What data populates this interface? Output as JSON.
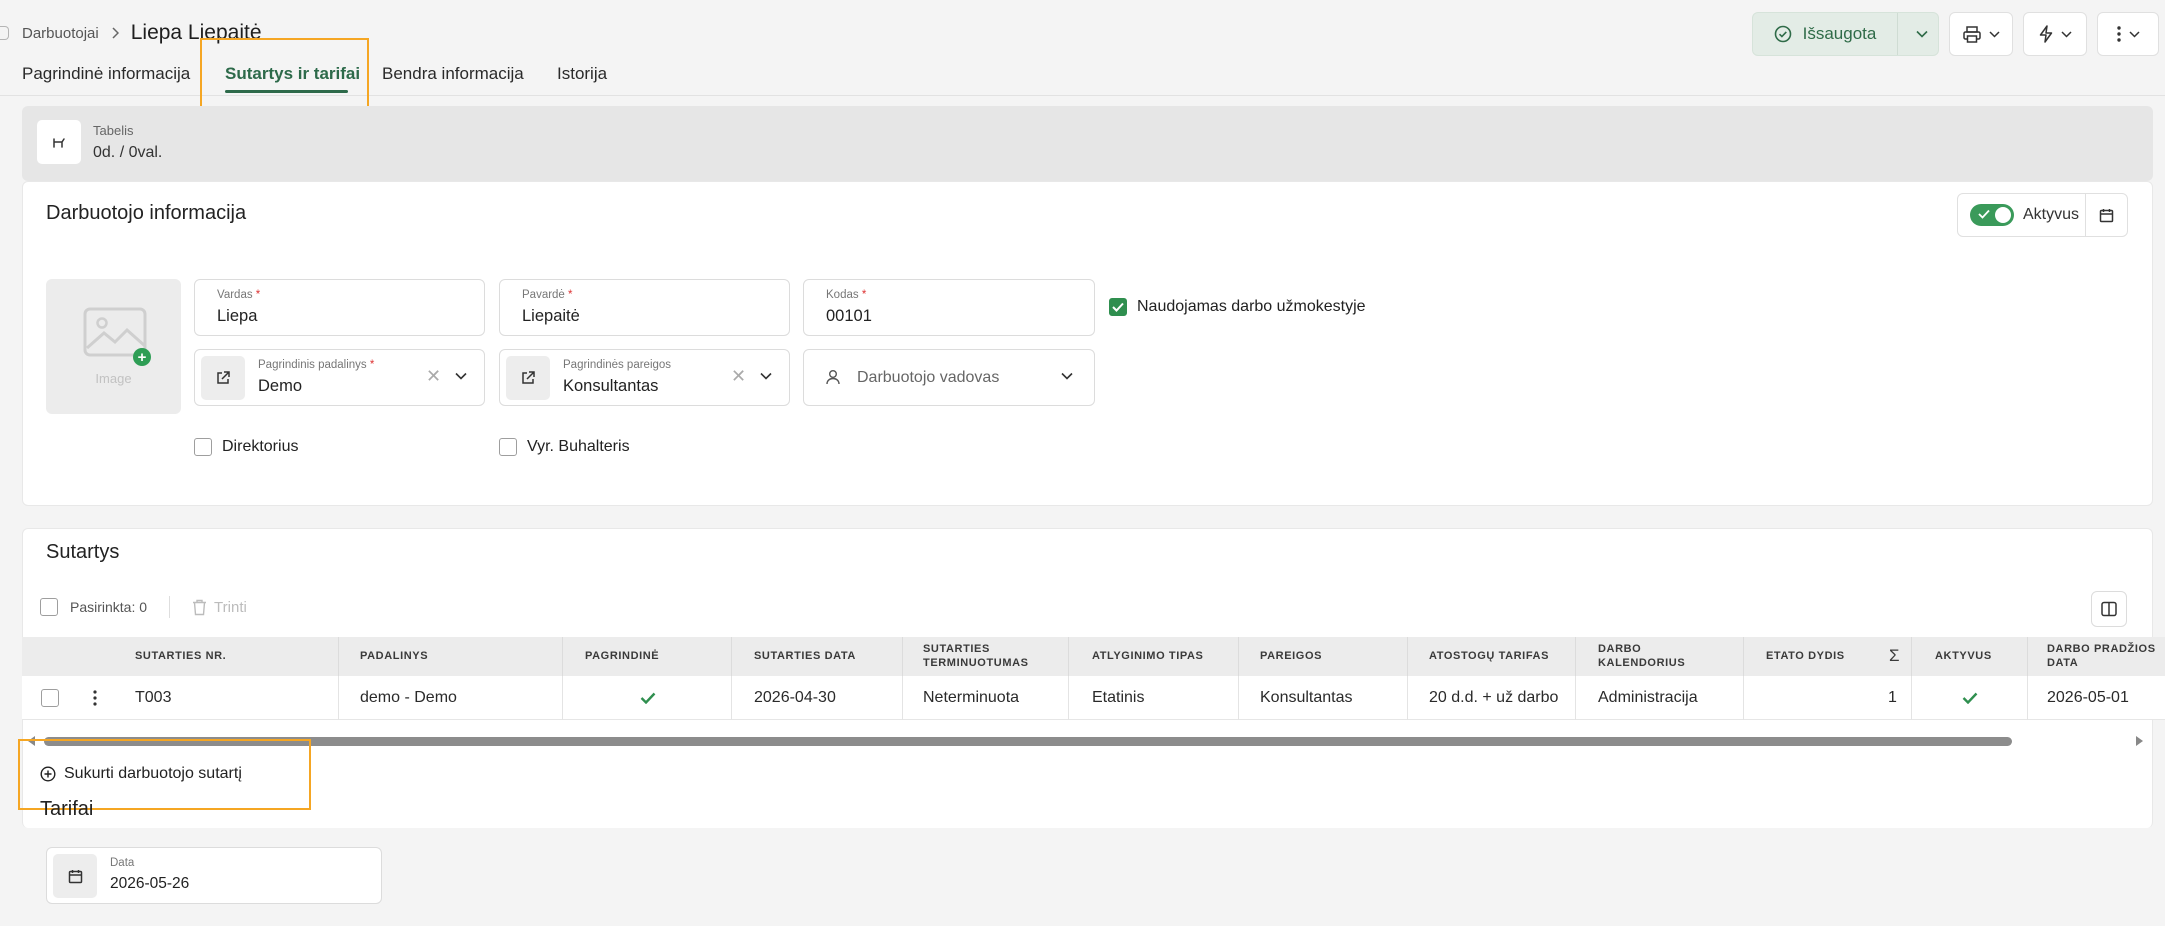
{
  "breadcrumb": {
    "parent": "Darbuotojai",
    "title": "Liepa Liepaitė"
  },
  "header": {
    "saved_label": "Išsaugota"
  },
  "tabs": [
    {
      "label": "Pagrindinė informacija"
    },
    {
      "label": "Sutartys ir tarifai",
      "active": true
    },
    {
      "label": "Bendra informacija"
    },
    {
      "label": "Istorija"
    }
  ],
  "tabelis": {
    "label": "Tabelis",
    "value": "0d. / 0val."
  },
  "employee": {
    "title": "Darbuotojo informacija",
    "active_label": "Aktyvus",
    "active": true,
    "image_label": "Image",
    "first_name": {
      "label": "Vardas",
      "value": "Liepa"
    },
    "last_name": {
      "label": "Pavardė",
      "value": "Liepaitė"
    },
    "code": {
      "label": "Kodas",
      "value": "00101"
    },
    "payroll": {
      "label": "Naudojamas darbo užmokestyje",
      "checked": true
    },
    "department": {
      "label": "Pagrindinis padalinys",
      "value": "Demo"
    },
    "position": {
      "label": "Pagrindinės pareigos",
      "value": "Konsultantas"
    },
    "manager": {
      "placeholder": "Darbuotojo vadovas"
    },
    "director": {
      "label": "Direktorius",
      "checked": false
    },
    "chief_accountant": {
      "label": "Vyr. Buhalteris",
      "checked": false
    }
  },
  "contracts": {
    "title": "Sutartys",
    "selected_label": "Pasirinkta: 0",
    "delete_label": "Trinti",
    "columns": [
      "Sutarties nr.",
      "Padalinys",
      "Pagrindinė",
      "Sutarties data",
      "Sutarties terminuotumas",
      "Atlyginimo tipas",
      "Pareigos",
      "Atostogų tarifas",
      "Darbo kalendorius",
      "Etato dydis",
      "Aktyvus",
      "Darbo pradžios data"
    ],
    "rows": [
      {
        "number": "T003",
        "department": "demo - Demo",
        "main": true,
        "date": "2026-04-30",
        "term": "Neterminuota",
        "salary_type": "Etatinis",
        "position": "Konsultantas",
        "vacation": "20 d.d. + už darbo",
        "calendar": "Administracija",
        "rate": "1",
        "active": true,
        "start_date": "2026-05-01"
      }
    ],
    "create_label": "Sukurti darbuotojo sutartį"
  },
  "tariffs": {
    "title": "Tarifai",
    "date": {
      "label": "Data",
      "value": "2026-05-26"
    }
  },
  "colors": {
    "accent": "#2d6a4a",
    "check": "#2f8f4f",
    "highlight": "#f5a623"
  }
}
